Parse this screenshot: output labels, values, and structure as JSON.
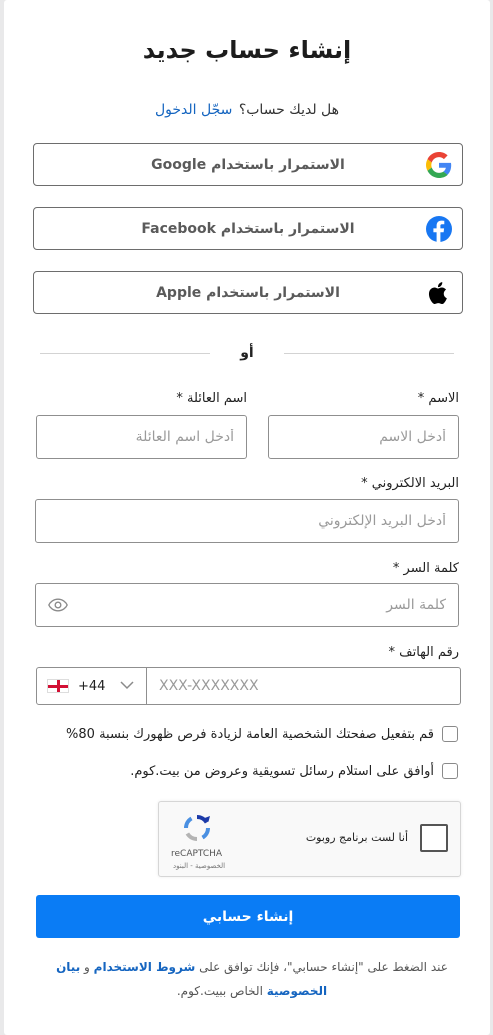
{
  "title": "إنشاء حساب جديد",
  "have_account": {
    "question": "هل لديك حساب؟",
    "login_link": "سجّل الدخول"
  },
  "social": {
    "google": "الاستمرار باستخدام Google",
    "facebook": "الاستمرار باستخدام Facebook",
    "apple": "الاستمرار باستخدام Apple"
  },
  "divider": "أو",
  "form": {
    "first_name": {
      "label": "الاسم *",
      "placeholder": "أدخل الاسم",
      "value": ""
    },
    "last_name": {
      "label": "اسم العائلة *",
      "placeholder": "أدخل اسم العائلة",
      "value": ""
    },
    "email": {
      "label": "البريد الالكتروني *",
      "placeholder": "أدخل البريد الإلكتروني",
      "value": ""
    },
    "password": {
      "label": "كلمة السر *",
      "placeholder": "كلمة السر",
      "value": ""
    },
    "phone": {
      "label": "رقم الهاتف *",
      "country_code": "+44",
      "placeholder": "XXX-XXXXXXX",
      "value": ""
    }
  },
  "checkboxes": {
    "public_profile": "قم بتفعيل صفحتك الشخصية العامة لزيادة فرص ظهورك بنسبة 80%",
    "marketing": "أوافق على استلام رسائل تسويقية وعروض من بيت.كوم."
  },
  "captcha": {
    "text": "أنا لست برنامج روبوت",
    "brand": "reCAPTCHA",
    "links": "الخصوصية - البنود"
  },
  "submit_label": "إنشاء حسابي",
  "terms": {
    "prefix": "عند الضغط على \"إنشاء حسابي\"، فإنك توافق على",
    "terms_link": "شروط الاستخدام",
    "and": "و",
    "privacy_link": "بيان الخصوصية",
    "suffix": "الخاص ببيت.كوم."
  },
  "colors": {
    "primary": "#0a7cf5",
    "link": "#1565c0",
    "border": "#8f8f8f"
  },
  "icons": [
    "google-icon",
    "facebook-icon",
    "apple-icon",
    "eye-icon",
    "chevron-down-icon",
    "flag-icon",
    "recaptcha-icon"
  ]
}
